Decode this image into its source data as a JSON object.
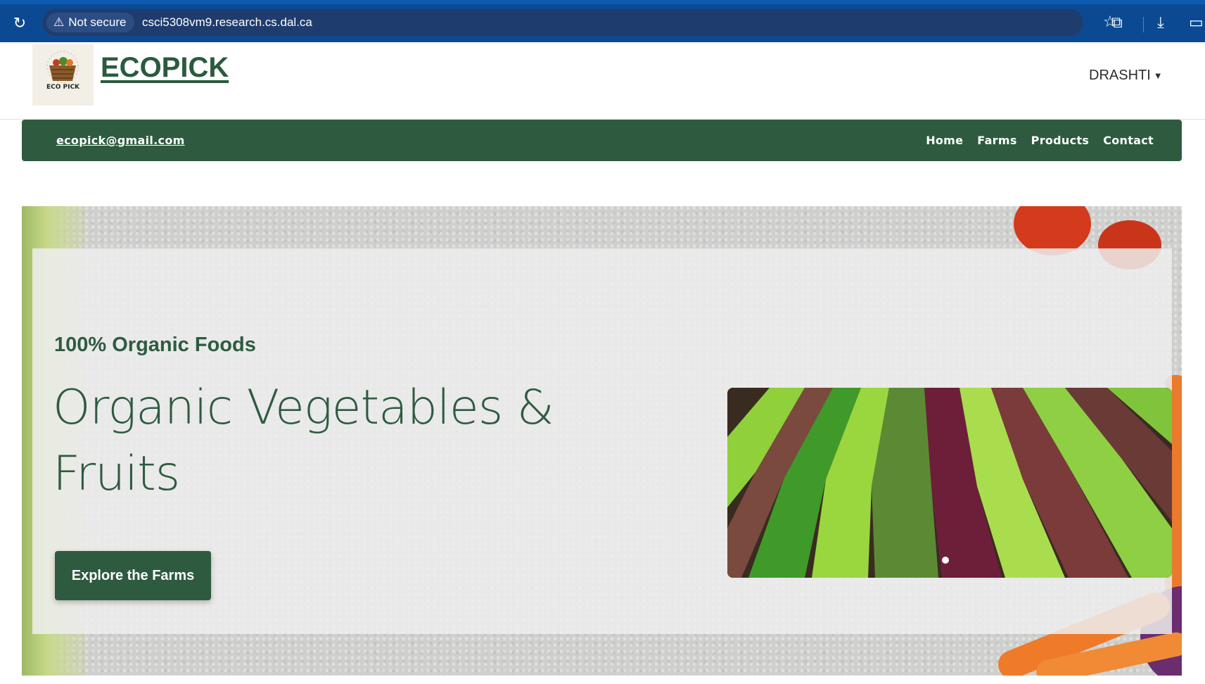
{
  "browser": {
    "security_label": "Not secure",
    "url": "csci5308vm9.research.cs.dal.ca"
  },
  "header": {
    "logo_text": "ECO PICK",
    "brand": "ECOPICK",
    "user_name": "DRASHTI"
  },
  "nav": {
    "email": "ecopick@gmail.com",
    "links": [
      "Home",
      "Farms",
      "Products",
      "Contact"
    ]
  },
  "hero": {
    "badge": "100% Organic Foods",
    "title": "Organic Vegetables & Fruits",
    "cta_label": "Explore the Farms"
  },
  "colors": {
    "browser_bar": "#0b4a92",
    "brand_green": "#2e5b40"
  }
}
